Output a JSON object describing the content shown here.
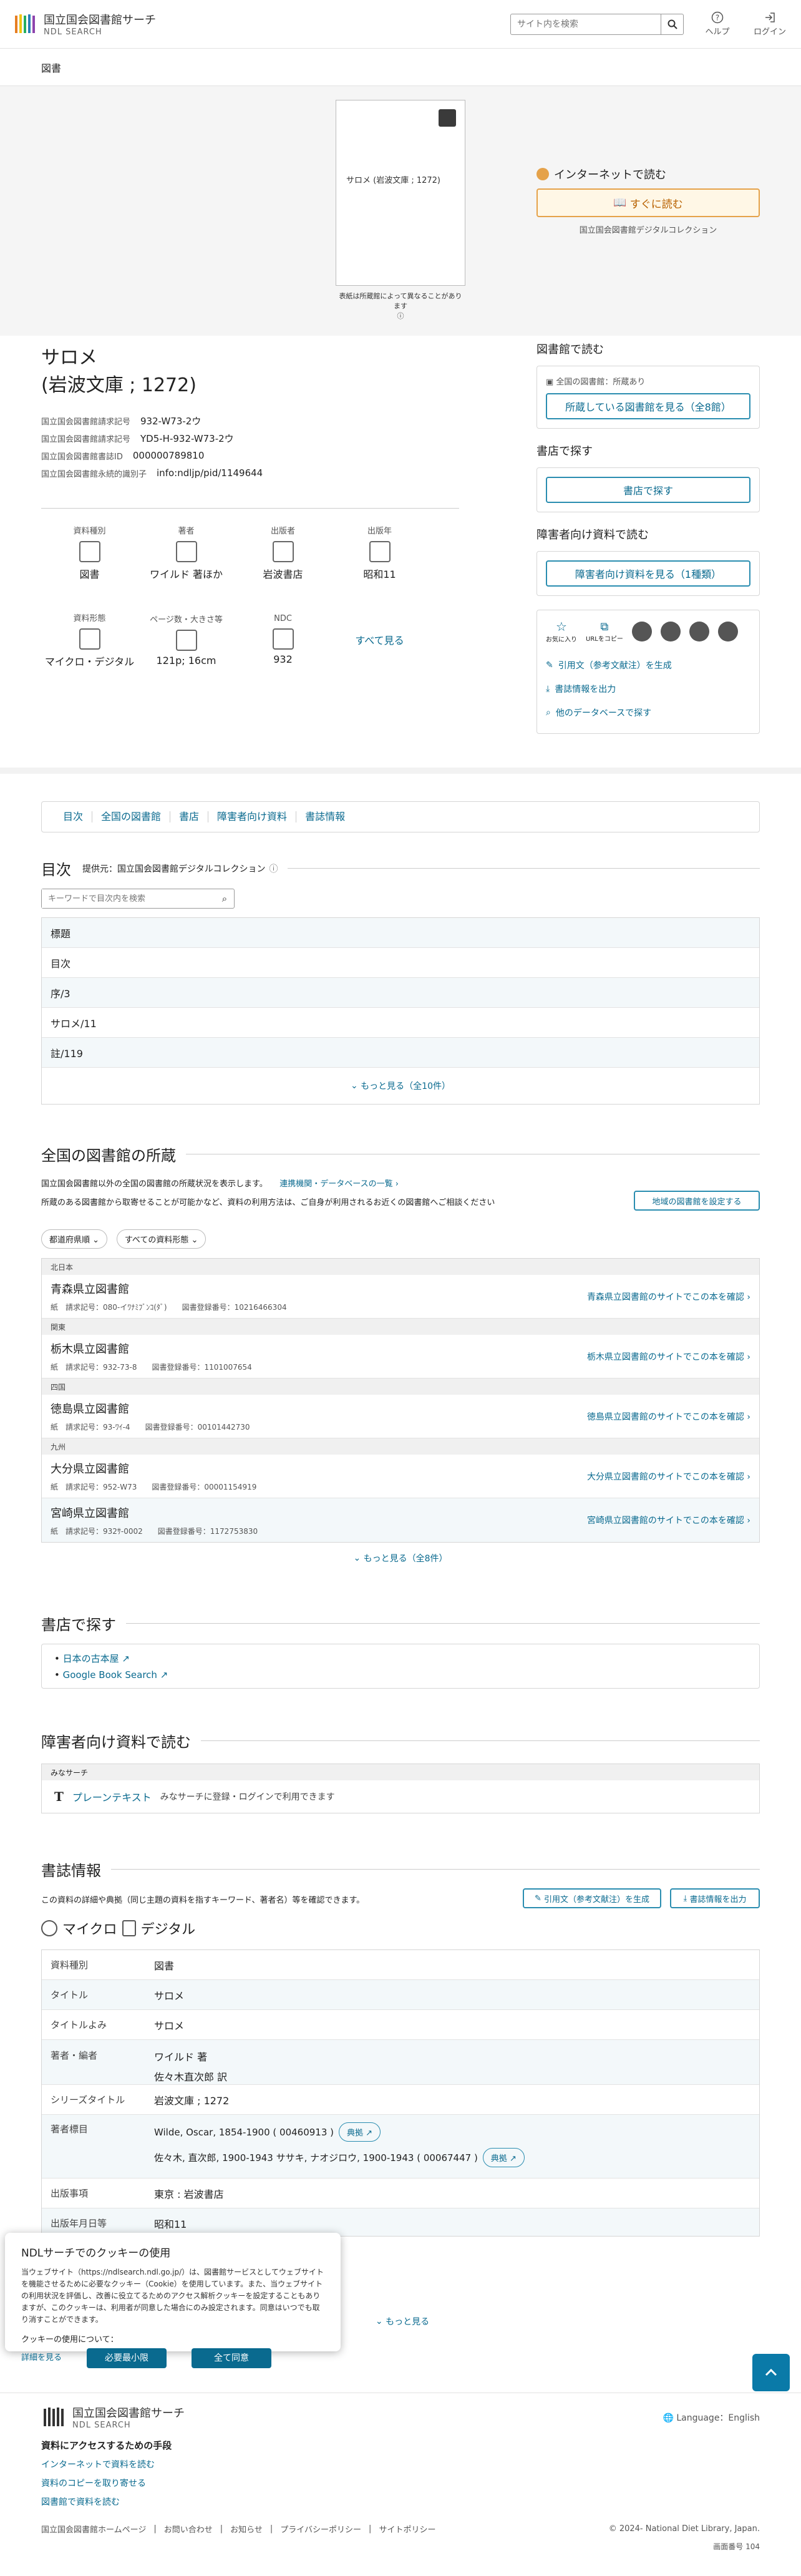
{
  "header": {
    "site_title": "国立国会図書館サーチ",
    "site_subtitle": "NDL SEARCH",
    "search_placeholder": "サイト内を検索",
    "help_label": "ヘルプ",
    "login_label": "ログイン"
  },
  "breadcrumb": {
    "label": "図書"
  },
  "cover": {
    "title_text": "サロメ (岩波文庫 ; 1272)",
    "note": "表紙は所蔵館によって異なることがあります"
  },
  "record": {
    "title_line1": "サロメ",
    "title_line2": "(岩波文庫 ; 1272)",
    "meta": [
      {
        "label": "国立国会図書館請求記号",
        "value": "932-W73-2ウ"
      },
      {
        "label": "国立国会図書館請求記号",
        "value": "YD5-H-932-W73-2ウ"
      },
      {
        "label": "国立国会図書館書誌ID",
        "value": "000000789810"
      },
      {
        "label": "国立国会図書館永続的識別子",
        "value": "info:ndljp/pid/1149644"
      }
    ],
    "facets_row1": [
      {
        "label": "資料種別",
        "value": "図書"
      },
      {
        "label": "著者",
        "value": "ワイルド 著ほか"
      },
      {
        "label": "出版者",
        "value": "岩波書店"
      },
      {
        "label": "出版年",
        "value": "昭和11"
      }
    ],
    "facets_row2": [
      {
        "label": "資料形態",
        "value": "マイクロ・デジタル"
      },
      {
        "label": "ページ数・大きさ等",
        "value": "121p; 16cm"
      },
      {
        "label": "NDC",
        "value": "932"
      }
    ],
    "see_all": "すべて見る"
  },
  "side": {
    "internet_heading": "インターネットで読む",
    "read_now": "すぐに読む",
    "read_source": "国立国会図書館デジタルコレクション",
    "library_heading": "図書館で読む",
    "library_status": "全国の図書館：所蔵あり",
    "library_button": "所蔵している図書館を見る（全8館）",
    "store_heading": "書店で探す",
    "store_button": "書店で探す",
    "accessible_heading": "障害者向け資料で読む",
    "accessible_button": "障害者向け資料を見る（1種類）",
    "favorite_label": "お気に入り",
    "copy_url_label": "URLをコピー",
    "cite_link": "引用文（参考文献注）を生成",
    "export_link": "書誌情報を出力",
    "other_db_link": "他のデータベースで探す"
  },
  "tabs": [
    "目次",
    "全国の図書館",
    "書店",
    "障害者向け資料",
    "書誌情報"
  ],
  "toc": {
    "heading": "目次",
    "provider": "提供元：国立国会図書館デジタルコレクション",
    "search_placeholder": "キーワードで目次内を検索",
    "rows": [
      "標題",
      "目次",
      "序/3",
      "サロメ/11",
      "註/119"
    ],
    "more": "もっと見る（全10件）"
  },
  "holdings": {
    "heading": "全国の図書館の所蔵",
    "intro": "国立国会図書館以外の全国の図書館の所蔵状況を表示します。",
    "partner_link": "連携機関・データベースの一覧",
    "note": "所蔵のある図書館から取寄せることが可能かなど、資料の利用方法は、ご自身が利用されるお近くの図書館へご相談ください",
    "set_region": "地域の図書館を設定する",
    "filter1": "都道府県順",
    "filter2": "すべての資料形態",
    "libs": [
      {
        "region": "北日本",
        "name": "青森県立図書館",
        "detail": "紙　請求記号：080-イﾜﾅﾐﾌﾞﾝｺ(ﾀﾞ)　　図書登録番号：10216466304",
        "link": "青森県立図書館のサイトでこの本を確認"
      },
      {
        "region": "関東",
        "name": "栃木県立図書館",
        "detail": "紙　請求記号：932-73-8　　図書登録番号：1101007654",
        "link": "栃木県立図書館のサイトでこの本を確認"
      },
      {
        "region": "四国",
        "name": "徳島県立図書館",
        "detail": "紙　請求記号：93-ﾜｲ-4　　図書登録番号：00101442730",
        "link": "徳島県立図書館のサイトでこの本を確認"
      },
      {
        "region": "九州",
        "name": "大分県立図書館",
        "detail": "紙　請求記号：952-W73　　図書登録番号：00001154919",
        "link": "大分県立図書館のサイトでこの本を確認"
      },
      {
        "region": "",
        "name": "宮崎県立図書館",
        "detail": "紙　請求記号：932ｻ-0002　　図書登録番号：1172753830",
        "link": "宮崎県立図書館のサイトでこの本を確認"
      }
    ],
    "more": "もっと見る（全8件）"
  },
  "store": {
    "heading": "書店で探す",
    "links": [
      "日本の古本屋",
      "Google Book Search"
    ]
  },
  "accessible": {
    "heading": "障害者向け資料で読む",
    "source": "みなサーチ",
    "format": "プレーンテキスト",
    "desc": "みなサーチに登録・ログインで利用できます"
  },
  "bib": {
    "heading": "書誌情報",
    "intro": "この資料の詳細や典拠（同じ主題の資料を指すキーワード、著者名）等を確認できます。",
    "cite_btn": "引用文（参考文献注）を生成",
    "export_btn": "書誌情報を出力",
    "form_prefix": "マイクロ",
    "form_suffix": "デジタル",
    "rows": [
      {
        "k": "資料種別",
        "v": "図書"
      },
      {
        "k": "タイトル",
        "v": "サロメ"
      },
      {
        "k": "タイトルよみ",
        "v": "サロメ"
      },
      {
        "k": "著者・編者",
        "v": "ワイルド 著"
      },
      {
        "k": "",
        "v": "佐々木直次郎 訳"
      },
      {
        "k": "シリーズタイトル",
        "v": "岩波文庫 ; 1272"
      },
      {
        "k": "著者標目",
        "v": "Wilde, Oscar, 1854-1900 ( 00460913 )"
      },
      {
        "k": "",
        "v": "佐々木, 直次郎, 1900-1943 ササキ, ナオジロウ, 1900-1943 ( 00067447 )"
      },
      {
        "k": "出版事項",
        "v": "東京 : 岩波書店"
      },
      {
        "k": "出版年月日等",
        "v": "昭和11"
      }
    ],
    "source_label": "典拠",
    "more": "もっと見る"
  },
  "cookie": {
    "title": "NDLサーチでのクッキーの使用",
    "body": "当ウェブサイト（https://ndlsearch.ndl.go.jp/）は、図書館サービスとしてウェブサイトを機能させるために必要なクッキー（Cookie）を使用しています。また、当ウェブサイトの利用状況を評価し、改善に役立てるためのアクセス解析クッキーを設定することもありますが、このクッキーは、利用者が同意した場合にのみ設定されます。同意はいつでも取り消すことができます。",
    "about": "クッキーの使用について：",
    "details": "詳細を見る",
    "necessary": "必要最小限",
    "agree": "全て同意"
  },
  "footer": {
    "site_title": "国立国会図書館サーチ",
    "site_subtitle": "NDL SEARCH",
    "language": "Language：English",
    "access_heading": "資料にアクセスするための手段",
    "links": [
      "インターネットで資料を読む",
      "資料のコピーを取り寄せる",
      "図書館で資料を読む"
    ],
    "bottom_links": [
      "国立国会図書館ホームページ",
      "お問い合わせ",
      "お知らせ",
      "プライバシーポリシー",
      "サイトポリシー"
    ],
    "copyright": "© 2024- National Diet Library, Japan.",
    "screen_no": "画面番号 104"
  }
}
